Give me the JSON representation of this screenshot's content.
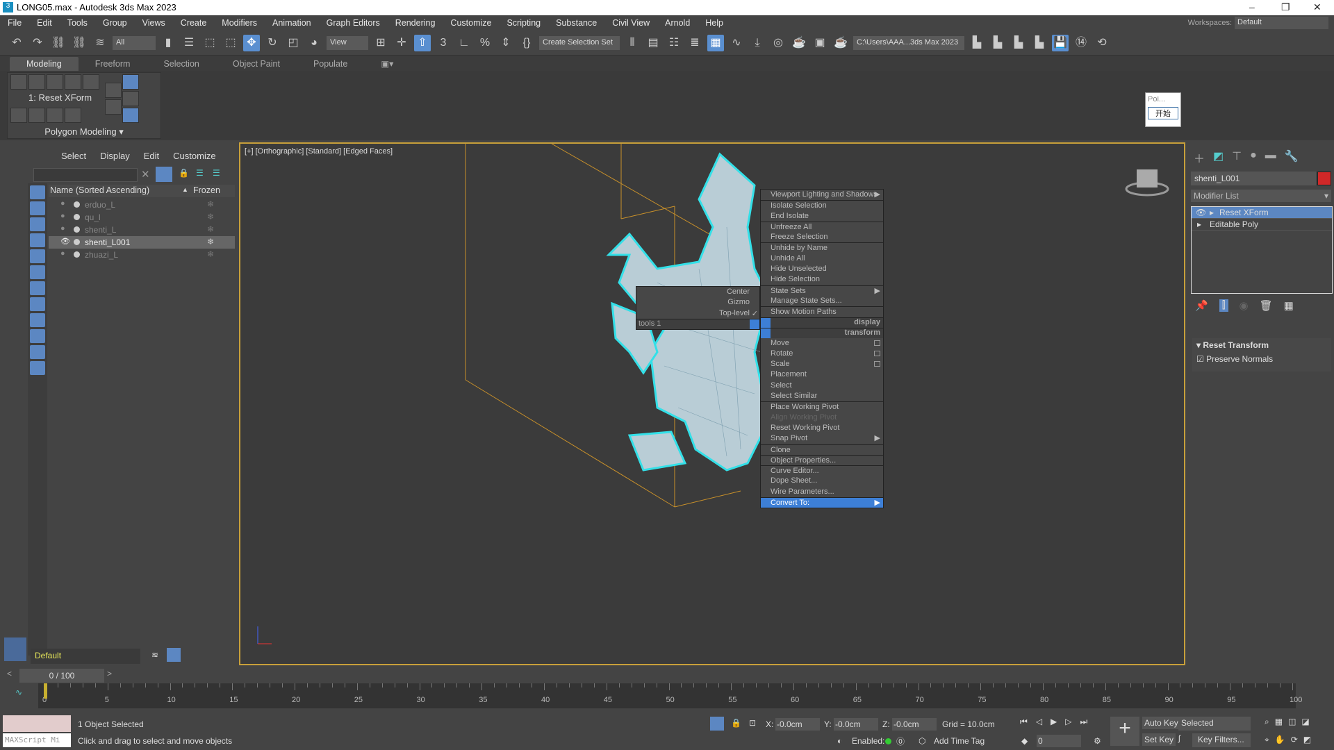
{
  "window": {
    "title": "LONG05.max - Autodesk 3ds Max 2023",
    "app_icon": "3"
  },
  "menu": [
    "File",
    "Edit",
    "Tools",
    "Group",
    "Views",
    "Create",
    "Modifiers",
    "Animation",
    "Graph Editors",
    "Rendering",
    "Customize",
    "Scripting",
    "Substance",
    "Civil View",
    "Arnold",
    "Help"
  ],
  "workspace": {
    "label": "Workspaces:",
    "value": "Default"
  },
  "toolbar": {
    "filter": "All",
    "ref_coord": "View",
    "selection_set": "Create Selection Set",
    "project_path": "C:\\Users\\AAA...3ds Max 2023"
  },
  "ribbon": {
    "tabs": [
      "Modeling",
      "Freeform",
      "Selection",
      "Object Paint",
      "Populate"
    ],
    "active": "Modeling",
    "modifier_label": "1: Reset XForm",
    "panel_title": "Polygon Modeling"
  },
  "popup": {
    "title": "Poi...",
    "button": "开始"
  },
  "explorer": {
    "menu": [
      "Select",
      "Display",
      "Edit",
      "Customize"
    ],
    "col_name": "Name (Sorted Ascending)",
    "col_frozen": "Frozen",
    "rows": [
      {
        "name": "erduo_L",
        "selected": false
      },
      {
        "name": "qu_l",
        "selected": false
      },
      {
        "name": "shenti_L",
        "selected": false
      },
      {
        "name": "shenti_L001",
        "selected": true
      },
      {
        "name": "zhuazi_L",
        "selected": false
      }
    ],
    "layer": "Default"
  },
  "viewport": {
    "label": "[+] [Orthographic] [Standard] [Edged Faces]",
    "accent": "#c8a03a",
    "selection_color": "#33e0e8"
  },
  "quad_menu": {
    "left": [
      {
        "label": "Center"
      },
      {
        "label": "Gizmo"
      },
      {
        "label": "Top-level",
        "checked": true
      }
    ],
    "left_title": "tools 1",
    "display_title": "display",
    "transform_title": "transform",
    "display": [
      {
        "label": "Viewport Lighting and Shadows",
        "sub": true
      },
      {
        "label": "Isolate Selection",
        "sep": true
      },
      {
        "label": "End Isolate"
      },
      {
        "label": "Unfreeze All",
        "sep": true
      },
      {
        "label": "Freeze Selection"
      },
      {
        "label": "Unhide by Name",
        "sep": true
      },
      {
        "label": "Unhide All"
      },
      {
        "label": "Hide Unselected"
      },
      {
        "label": "Hide Selection"
      },
      {
        "label": "State Sets",
        "sub": true,
        "sep": true
      },
      {
        "label": "Manage State Sets..."
      },
      {
        "label": "Show Motion Paths",
        "sep": true
      }
    ],
    "transform": [
      {
        "label": "Move",
        "box": true
      },
      {
        "label": "Rotate",
        "box": true
      },
      {
        "label": "Scale",
        "box": true
      },
      {
        "label": "Placement"
      },
      {
        "label": "Select"
      },
      {
        "label": "Select Similar"
      },
      {
        "label": "Place Working Pivot",
        "sep": true
      },
      {
        "label": "Align Working Pivot",
        "disabled": true
      },
      {
        "label": "Reset Working Pivot"
      },
      {
        "label": "Snap Pivot",
        "sub": true
      },
      {
        "label": "Clone",
        "sep": true
      },
      {
        "label": "Object Properties...",
        "sep": true
      },
      {
        "label": "Curve Editor...",
        "sep": true
      },
      {
        "label": "Dope Sheet..."
      },
      {
        "label": "Wire Parameters..."
      },
      {
        "label": "Convert To:",
        "sub": true,
        "highlight": true,
        "sep": true
      }
    ]
  },
  "command_panel": {
    "object_name": "shenti_L001",
    "object_color": "#d02828",
    "modifier_list": "Modifier List",
    "stack": [
      {
        "label": "Reset XForm",
        "selected": true
      },
      {
        "label": "Editable Poly",
        "selected": false
      }
    ],
    "rollout_title": "Reset Transform",
    "preserve_normals": {
      "label": "Preserve Normals",
      "checked": true
    }
  },
  "timeline": {
    "position": "0 / 100",
    "ticks": [
      0,
      5,
      10,
      15,
      20,
      25,
      30,
      35,
      40,
      45,
      50,
      55,
      60,
      65,
      70,
      75,
      80,
      85,
      90,
      95,
      100
    ]
  },
  "status": {
    "selected": "1 Object Selected",
    "prompt": "Click and drag to select and move objects",
    "maxscript": "MAXScript Mi",
    "x": "-0.0cm",
    "y": "-0.0cm",
    "z": "-0.0cm",
    "grid": "Grid = 10.0cm",
    "enabled": "Enabled:",
    "add_time_tag": "Add Time Tag",
    "auto_key": "Auto Key",
    "set_key": "Set Key",
    "key_mode": "Selected",
    "key_filters": "Key Filters...",
    "frame": "0",
    "x_label": "X:",
    "y_label": "Y:",
    "z_label": "Z:"
  }
}
